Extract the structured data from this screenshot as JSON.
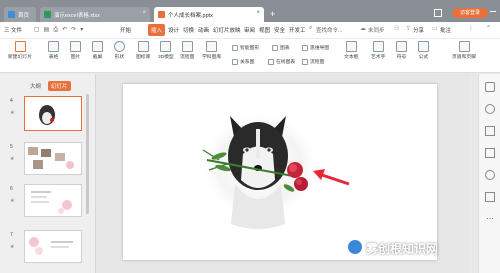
{
  "tabs": [
    {
      "label": "首页",
      "active": false
    },
    {
      "label": "演示excel表格.xlsx",
      "active": false
    },
    {
      "label": "个人成长档案.pptx",
      "active": true
    }
  ],
  "titlebar": {
    "new_tab": "+",
    "login": "访客登录"
  },
  "menu": {
    "file": "三 文件",
    "items": [
      "开始",
      "插入",
      "设计",
      "切换",
      "动画",
      "幻灯片放映",
      "审阅",
      "视图",
      "安全",
      "开发工"
    ],
    "search": "查找命令...",
    "sync": "未同步",
    "share": "分享",
    "comment": "批注"
  },
  "toolbar": {
    "tools": [
      "新建幻灯片",
      "表格",
      "图片",
      "截屏",
      "形状",
      "图标库",
      "3D模型",
      "流程图",
      "学科图库"
    ],
    "smart": "智能图形",
    "chart": "图表",
    "mindmap": "思维导图",
    "relation": "关系图",
    "online_chart": "在线图表",
    "flow": "流程图",
    "textbox": "文本框",
    "art": "艺术字",
    "symbol": "符号",
    "formula": "公式",
    "header": "页眉和页脚"
  },
  "panel": {
    "outline": "大纲",
    "slides": "幻灯片"
  },
  "thumbnails": [
    {
      "num": "4",
      "star": "★"
    },
    {
      "num": "5",
      "star": "★"
    },
    {
      "num": "6",
      "star": "★"
    },
    {
      "num": "7",
      "star": "★"
    }
  ],
  "watermark": "雾创根知识网",
  "colors": {
    "accent": "#e8703a",
    "titlebar": "#8a8f96",
    "arrow": "#e8253b"
  }
}
